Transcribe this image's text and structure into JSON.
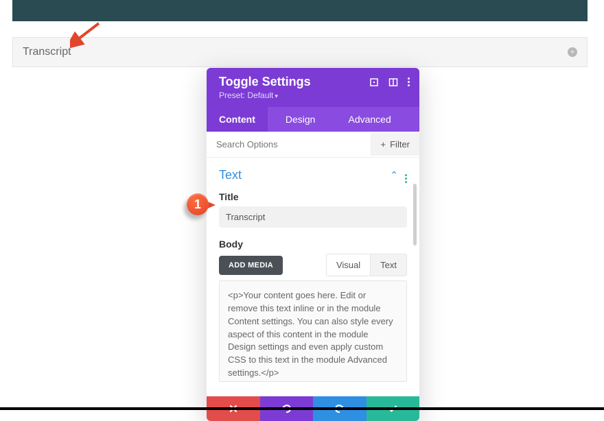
{
  "toggle": {
    "title": "Transcript"
  },
  "panel": {
    "header": "Toggle Settings",
    "preset_label": "Preset: Default",
    "tabs": {
      "content": "Content",
      "design": "Design",
      "advanced": "Advanced"
    },
    "search_placeholder": "Search Options",
    "filter_label": "Filter",
    "section_title": "Text",
    "title_label": "Title",
    "title_value": "Transcript",
    "body_label": "Body",
    "add_media": "ADD MEDIA",
    "editor_tabs": {
      "visual": "Visual",
      "text": "Text"
    },
    "body_value": "<p>Your content goes here. Edit or remove this text inline or in the module Content settings. You can also style every aspect of this content in the module Design settings and even apply custom CSS to this text in the module Advanced settings.</p>"
  },
  "callout": {
    "num": "1"
  },
  "icons": {
    "plus": "+",
    "filter_plus": "+",
    "chev_up": "⌃"
  }
}
